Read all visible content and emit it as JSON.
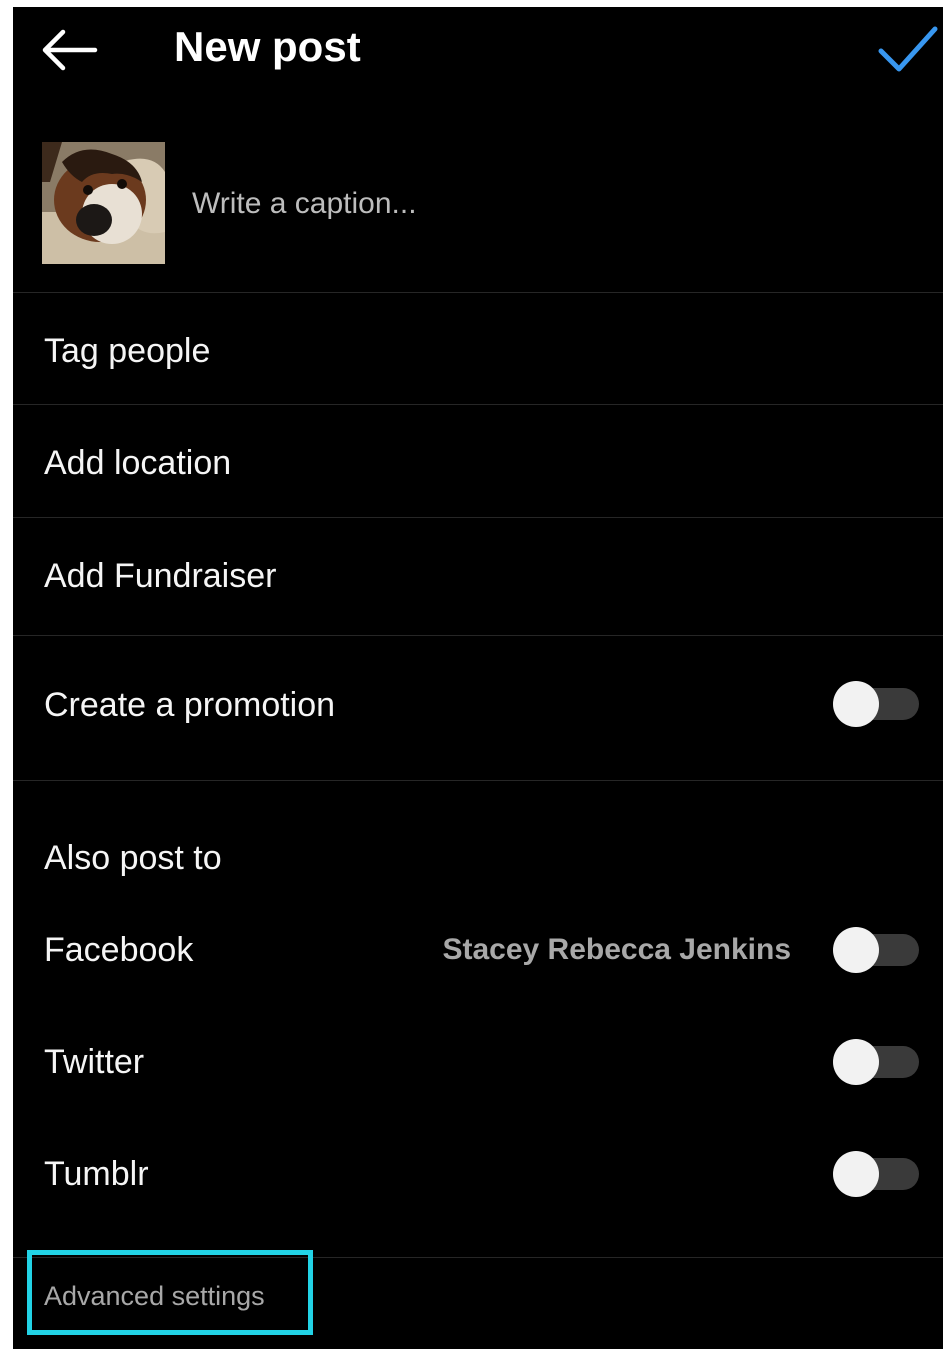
{
  "header": {
    "title": "New post",
    "back_icon": "arrow-left-icon",
    "confirm_icon": "checkmark-icon"
  },
  "caption": {
    "placeholder": "Write a caption...",
    "value": ""
  },
  "thumbnail": {
    "subject": "dog-photo"
  },
  "rows": {
    "tag_people": "Tag people",
    "add_location": "Add location",
    "add_fundraiser": "Add Fundraiser",
    "create_promotion": "Create a promotion"
  },
  "also_post_to": {
    "heading": "Also post to",
    "facebook": {
      "label": "Facebook",
      "account": "Stacey Rebecca Jenkins",
      "enabled": false
    },
    "twitter": {
      "label": "Twitter",
      "enabled": false
    },
    "tumblr": {
      "label": "Tumblr",
      "enabled": false
    }
  },
  "promotion_enabled": false,
  "advanced_settings": "Advanced settings",
  "colors": {
    "background": "#000000",
    "accent": "#3897f0",
    "divider": "#262626",
    "secondary_text": "#a8a8a8",
    "highlight": "#22d3e6"
  }
}
